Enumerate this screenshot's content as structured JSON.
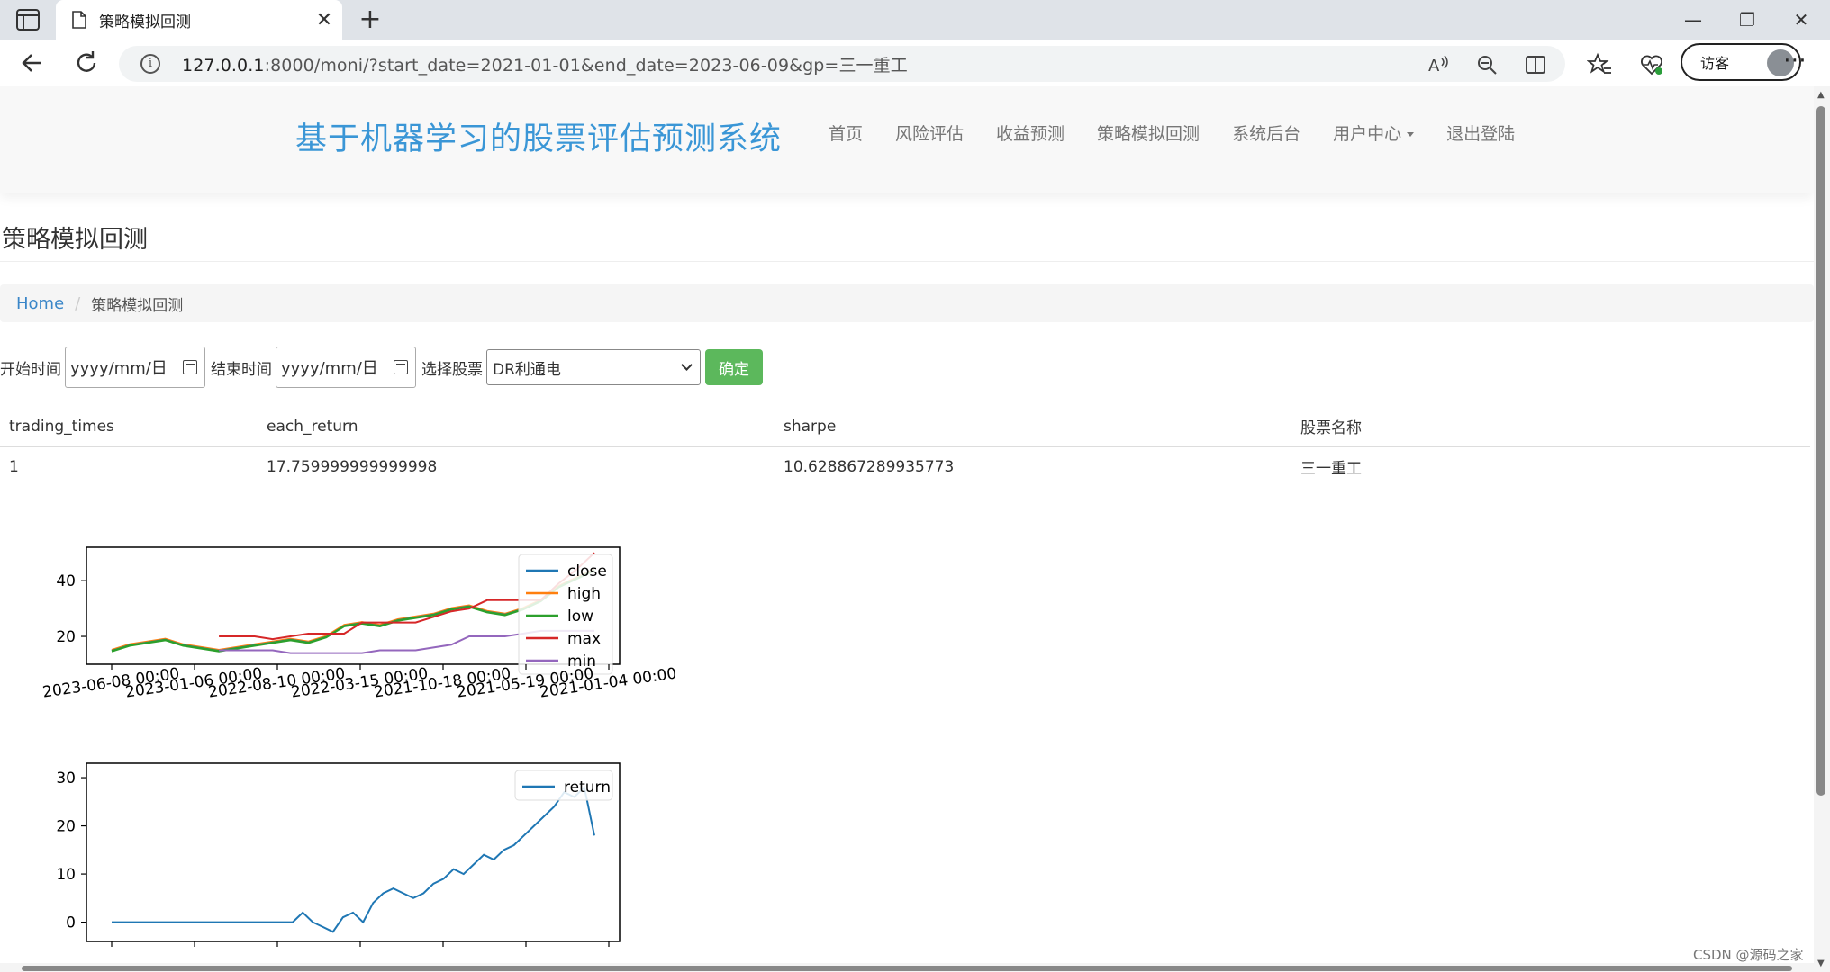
{
  "browser": {
    "tab_title": "策略模拟回测",
    "url_host": "127.0.0.1",
    "url_rest": ":8000/moni/?start_date=2021-01-01&end_date=2023-06-09&gp=三一重工",
    "profile_label": "访客",
    "icons": [
      "sidebar-icon",
      "page-icon",
      "close-icon",
      "plus-icon",
      "minimize-icon",
      "restore-icon",
      "window-close-icon",
      "back-icon",
      "reload-icon",
      "info-icon",
      "read-aloud-icon",
      "zoom-icon",
      "split-screen-icon",
      "favorites-icon",
      "health-icon",
      "more-icon"
    ]
  },
  "nav": {
    "brand": "基于机器学习的股票评估预测系统",
    "items": [
      "首页",
      "风险评估",
      "收益预测",
      "策略模拟回测",
      "系统后台",
      "用户中心",
      "退出登陆"
    ]
  },
  "page": {
    "title": "策略模拟回测",
    "breadcrumb": {
      "home": "Home",
      "current": "策略模拟回测"
    }
  },
  "form": {
    "start_label": "开始时间",
    "start_placeholder": "yyyy/mm/日",
    "end_label": "结束时间",
    "end_placeholder": "yyyy/mm/日",
    "stock_label": "选择股票",
    "stock_selected": "DR利通电",
    "submit_label": "确定"
  },
  "table": {
    "headers": [
      "trading_times",
      "each_return",
      "sharpe",
      "股票名称"
    ],
    "rows": [
      [
        "1",
        "17.759999999999998",
        "10.628867289935773",
        "三一重工"
      ]
    ]
  },
  "chart_data": [
    {
      "type": "line",
      "legend": [
        "close",
        "high",
        "low",
        "max",
        "min"
      ],
      "legend_position": "top-right",
      "x_tick_labels": [
        "2023-06-08 00:00",
        "2023-01-06 00:00",
        "2022-08-10 00:00",
        "2022-03-15 00:00",
        "2021-10-18 00:00",
        "2021-05-19 00:00",
        "2021-01-04 00:00"
      ],
      "y_ticks": [
        20,
        40
      ],
      "ylim": [
        10,
        52
      ],
      "colors": {
        "close": "#1f77b4",
        "high": "#ff7f0e",
        "low": "#2ca02c",
        "max": "#d62728",
        "min": "#9467bd"
      },
      "series": [
        {
          "name": "close",
          "values": [
            15,
            17,
            18,
            19,
            17,
            16,
            15,
            16,
            17,
            18,
            19,
            18,
            20,
            24,
            25,
            24,
            26,
            27,
            28,
            30,
            31,
            29,
            28,
            30,
            33,
            38,
            41,
            44
          ]
        },
        {
          "name": "max",
          "values": [
            null,
            null,
            null,
            null,
            null,
            null,
            20,
            20,
            20,
            19,
            20,
            21,
            21,
            21,
            25,
            25,
            25,
            25,
            27,
            29,
            30,
            33,
            33,
            33,
            33,
            39,
            44,
            50
          ]
        },
        {
          "name": "min",
          "values": [
            null,
            null,
            null,
            null,
            null,
            null,
            15,
            15,
            15,
            15,
            14,
            14,
            14,
            14,
            14,
            15,
            15,
            15,
            16,
            17,
            20,
            20,
            20,
            21,
            22,
            22,
            22,
            22
          ]
        }
      ]
    },
    {
      "type": "line",
      "legend": [
        "return"
      ],
      "legend_position": "top-right",
      "y_ticks": [
        0,
        10,
        20,
        30
      ],
      "ylim": [
        -4,
        33
      ],
      "colors": {
        "return": "#1f77b4"
      },
      "series": [
        {
          "name": "return",
          "values": [
            0,
            0,
            0,
            0,
            0,
            0,
            0,
            0,
            0,
            0,
            0,
            0,
            0,
            0,
            0,
            0,
            0,
            0,
            0,
            2,
            0,
            -1,
            -2,
            1,
            2,
            0,
            4,
            6,
            7,
            6,
            5,
            6,
            8,
            9,
            11,
            10,
            12,
            14,
            13,
            15,
            16,
            18,
            20,
            22,
            24,
            27,
            26,
            28,
            18
          ]
        }
      ]
    }
  ],
  "watermark": "CSDN @源码之家"
}
